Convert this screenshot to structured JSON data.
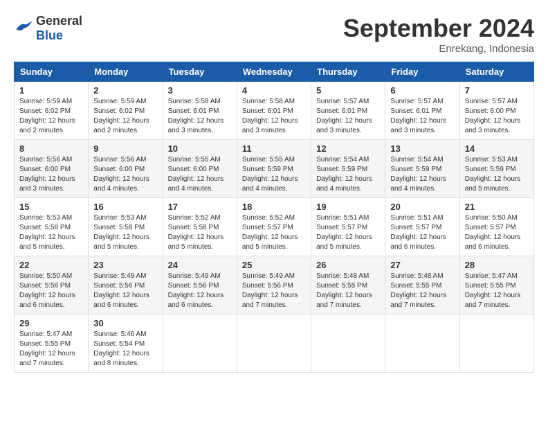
{
  "header": {
    "logo": {
      "general": "General",
      "blue": "Blue"
    },
    "title": "September 2024",
    "location": "Enrekang, Indonesia"
  },
  "weekdays": [
    "Sunday",
    "Monday",
    "Tuesday",
    "Wednesday",
    "Thursday",
    "Friday",
    "Saturday"
  ],
  "weeks": [
    [
      {
        "day": "1",
        "sunrise": "5:59 AM",
        "sunset": "6:02 PM",
        "daylight": "12 hours and 2 minutes."
      },
      {
        "day": "2",
        "sunrise": "5:59 AM",
        "sunset": "6:02 PM",
        "daylight": "12 hours and 2 minutes."
      },
      {
        "day": "3",
        "sunrise": "5:58 AM",
        "sunset": "6:01 PM",
        "daylight": "12 hours and 3 minutes."
      },
      {
        "day": "4",
        "sunrise": "5:58 AM",
        "sunset": "6:01 PM",
        "daylight": "12 hours and 3 minutes."
      },
      {
        "day": "5",
        "sunrise": "5:57 AM",
        "sunset": "6:01 PM",
        "daylight": "12 hours and 3 minutes."
      },
      {
        "day": "6",
        "sunrise": "5:57 AM",
        "sunset": "6:01 PM",
        "daylight": "12 hours and 3 minutes."
      },
      {
        "day": "7",
        "sunrise": "5:57 AM",
        "sunset": "6:00 PM",
        "daylight": "12 hours and 3 minutes."
      }
    ],
    [
      {
        "day": "8",
        "sunrise": "5:56 AM",
        "sunset": "6:00 PM",
        "daylight": "12 hours and 3 minutes."
      },
      {
        "day": "9",
        "sunrise": "5:56 AM",
        "sunset": "6:00 PM",
        "daylight": "12 hours and 4 minutes."
      },
      {
        "day": "10",
        "sunrise": "5:55 AM",
        "sunset": "6:00 PM",
        "daylight": "12 hours and 4 minutes."
      },
      {
        "day": "11",
        "sunrise": "5:55 AM",
        "sunset": "5:59 PM",
        "daylight": "12 hours and 4 minutes."
      },
      {
        "day": "12",
        "sunrise": "5:54 AM",
        "sunset": "5:59 PM",
        "daylight": "12 hours and 4 minutes."
      },
      {
        "day": "13",
        "sunrise": "5:54 AM",
        "sunset": "5:59 PM",
        "daylight": "12 hours and 4 minutes."
      },
      {
        "day": "14",
        "sunrise": "5:53 AM",
        "sunset": "5:59 PM",
        "daylight": "12 hours and 5 minutes."
      }
    ],
    [
      {
        "day": "15",
        "sunrise": "5:53 AM",
        "sunset": "5:58 PM",
        "daylight": "12 hours and 5 minutes."
      },
      {
        "day": "16",
        "sunrise": "5:53 AM",
        "sunset": "5:58 PM",
        "daylight": "12 hours and 5 minutes."
      },
      {
        "day": "17",
        "sunrise": "5:52 AM",
        "sunset": "5:58 PM",
        "daylight": "12 hours and 5 minutes."
      },
      {
        "day": "18",
        "sunrise": "5:52 AM",
        "sunset": "5:57 PM",
        "daylight": "12 hours and 5 minutes."
      },
      {
        "day": "19",
        "sunrise": "5:51 AM",
        "sunset": "5:57 PM",
        "daylight": "12 hours and 5 minutes."
      },
      {
        "day": "20",
        "sunrise": "5:51 AM",
        "sunset": "5:57 PM",
        "daylight": "12 hours and 6 minutes."
      },
      {
        "day": "21",
        "sunrise": "5:50 AM",
        "sunset": "5:57 PM",
        "daylight": "12 hours and 6 minutes."
      }
    ],
    [
      {
        "day": "22",
        "sunrise": "5:50 AM",
        "sunset": "5:56 PM",
        "daylight": "12 hours and 6 minutes."
      },
      {
        "day": "23",
        "sunrise": "5:49 AM",
        "sunset": "5:56 PM",
        "daylight": "12 hours and 6 minutes."
      },
      {
        "day": "24",
        "sunrise": "5:49 AM",
        "sunset": "5:56 PM",
        "daylight": "12 hours and 6 minutes."
      },
      {
        "day": "25",
        "sunrise": "5:49 AM",
        "sunset": "5:56 PM",
        "daylight": "12 hours and 7 minutes."
      },
      {
        "day": "26",
        "sunrise": "5:48 AM",
        "sunset": "5:55 PM",
        "daylight": "12 hours and 7 minutes."
      },
      {
        "day": "27",
        "sunrise": "5:48 AM",
        "sunset": "5:55 PM",
        "daylight": "12 hours and 7 minutes."
      },
      {
        "day": "28",
        "sunrise": "5:47 AM",
        "sunset": "5:55 PM",
        "daylight": "12 hours and 7 minutes."
      }
    ],
    [
      {
        "day": "29",
        "sunrise": "5:47 AM",
        "sunset": "5:55 PM",
        "daylight": "12 hours and 7 minutes."
      },
      {
        "day": "30",
        "sunrise": "5:46 AM",
        "sunset": "5:54 PM",
        "daylight": "12 hours and 8 minutes."
      },
      null,
      null,
      null,
      null,
      null
    ]
  ]
}
